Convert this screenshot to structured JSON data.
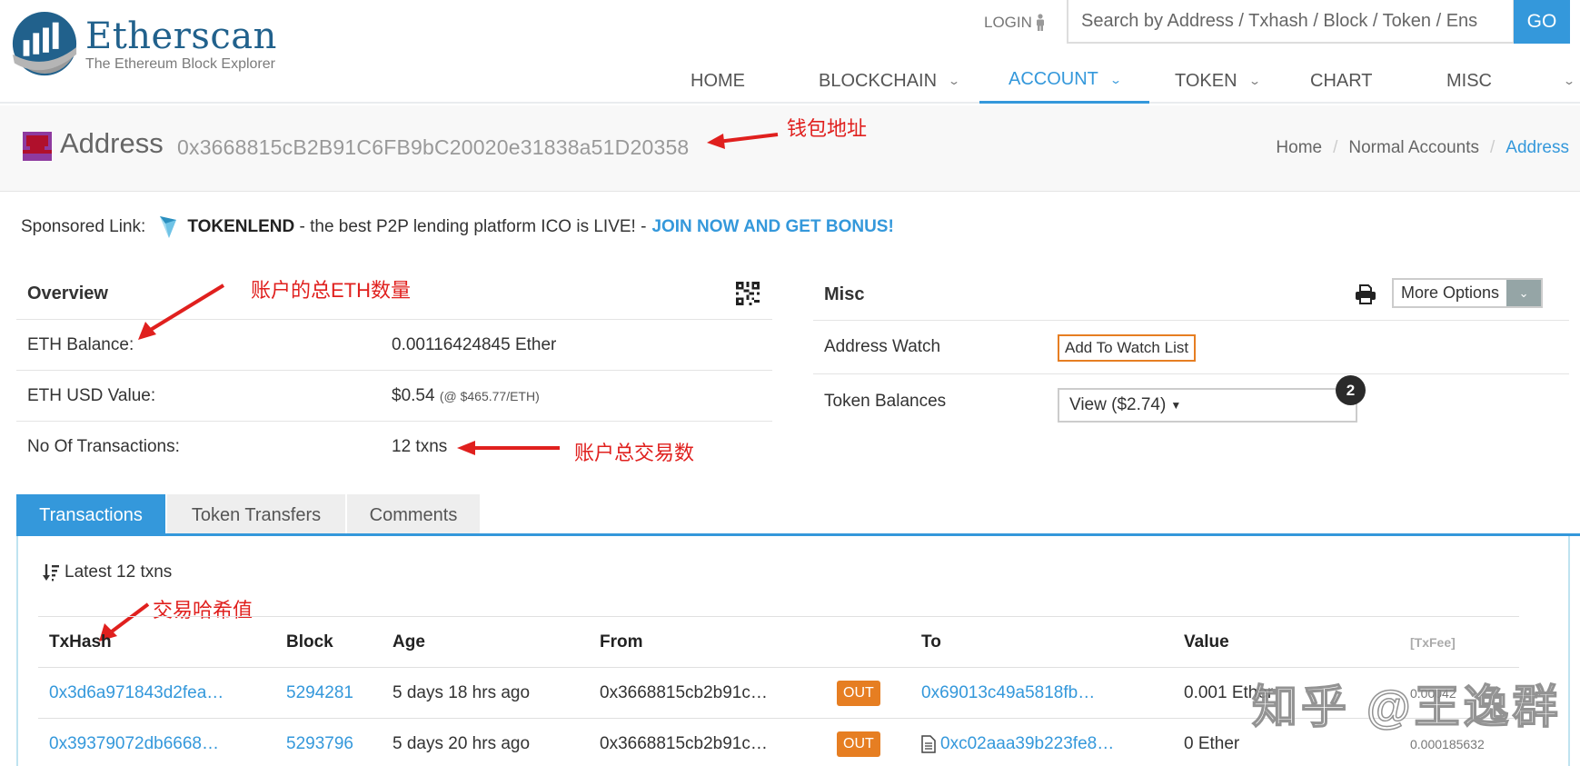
{
  "header": {
    "logo_title": "Etherscan",
    "logo_subtitle": "The Ethereum Block Explorer",
    "login_label": "LOGIN",
    "search_placeholder": "Search by Address / Txhash / Block / Token / Ens",
    "go_label": "GO",
    "nav": [
      {
        "label": "HOME",
        "has_dropdown": false,
        "active": false
      },
      {
        "label": "BLOCKCHAIN",
        "has_dropdown": true,
        "active": false
      },
      {
        "label": "ACCOUNT",
        "has_dropdown": true,
        "active": true
      },
      {
        "label": "TOKEN",
        "has_dropdown": true,
        "active": false
      },
      {
        "label": "CHART",
        "has_dropdown": false,
        "active": false
      },
      {
        "label": "MISC",
        "has_dropdown": true,
        "active": false
      }
    ]
  },
  "address_bar": {
    "label": "Address",
    "value": "0x3668815cB2B91C6FB9bC20020e31838a51D20358",
    "breadcrumb": [
      "Home",
      "Normal Accounts",
      "Address"
    ]
  },
  "sponsored": {
    "label": "Sponsored Link:",
    "brand": "TOKENLEND",
    "text": " - the best P2P lending platform ICO is LIVE! -",
    "cta": "JOIN NOW AND GET BONUS!"
  },
  "overview": {
    "title": "Overview",
    "rows": [
      {
        "label": "ETH Balance:",
        "value": "0.00116424845 Ether",
        "note": ""
      },
      {
        "label": "ETH USD Value:",
        "value": "$0.54",
        "note": "(@ $465.77/ETH)"
      },
      {
        "label": "No Of Transactions:",
        "value": "12 txns",
        "note": ""
      }
    ]
  },
  "misc": {
    "title": "Misc",
    "more_options_label": "More Options",
    "address_watch_label": "Address Watch",
    "add_watch_label": "Add To Watch List",
    "token_balances_label": "Token Balances",
    "token_balances_value": "View ($2.74)",
    "token_count": "2"
  },
  "tabs": [
    {
      "label": "Transactions",
      "active": true
    },
    {
      "label": "Token Transfers",
      "active": false
    },
    {
      "label": "Comments",
      "active": false
    }
  ],
  "transactions": {
    "summary": "Latest 12 txns",
    "columns": [
      "TxHash",
      "Block",
      "Age",
      "From",
      "",
      "To",
      "Value",
      "[TxFee]"
    ],
    "rows": [
      {
        "txhash": "0x3d6a971843d2fea…",
        "block": "5294281",
        "age": "5 days 18 hrs ago",
        "from": "0x3668815cb2b91c…",
        "direction": "OUT",
        "to": "0x69013c49a5818fb…",
        "to_is_contract": false,
        "value": "0.001 Ether",
        "fee": "0.00042"
      },
      {
        "txhash": "0x39379072db6668…",
        "block": "5293796",
        "age": "5 days 20 hrs ago",
        "from": "0x3668815cb2b91c…",
        "direction": "OUT",
        "to": "0xc02aaa39b223fe8…",
        "to_is_contract": true,
        "value": "0 Ether",
        "fee": "0.000185632"
      }
    ]
  },
  "annotations": {
    "wallet_address": "钱包地址",
    "eth_total": "账户的总ETH数量",
    "txn_total": "账户总交易数",
    "tx_hash": "交易哈希值"
  },
  "watermark": "知乎 @王逸群",
  "colors": {
    "accent": "#3498db",
    "out_badge": "#e67e22",
    "annotation": "#e0201e"
  }
}
